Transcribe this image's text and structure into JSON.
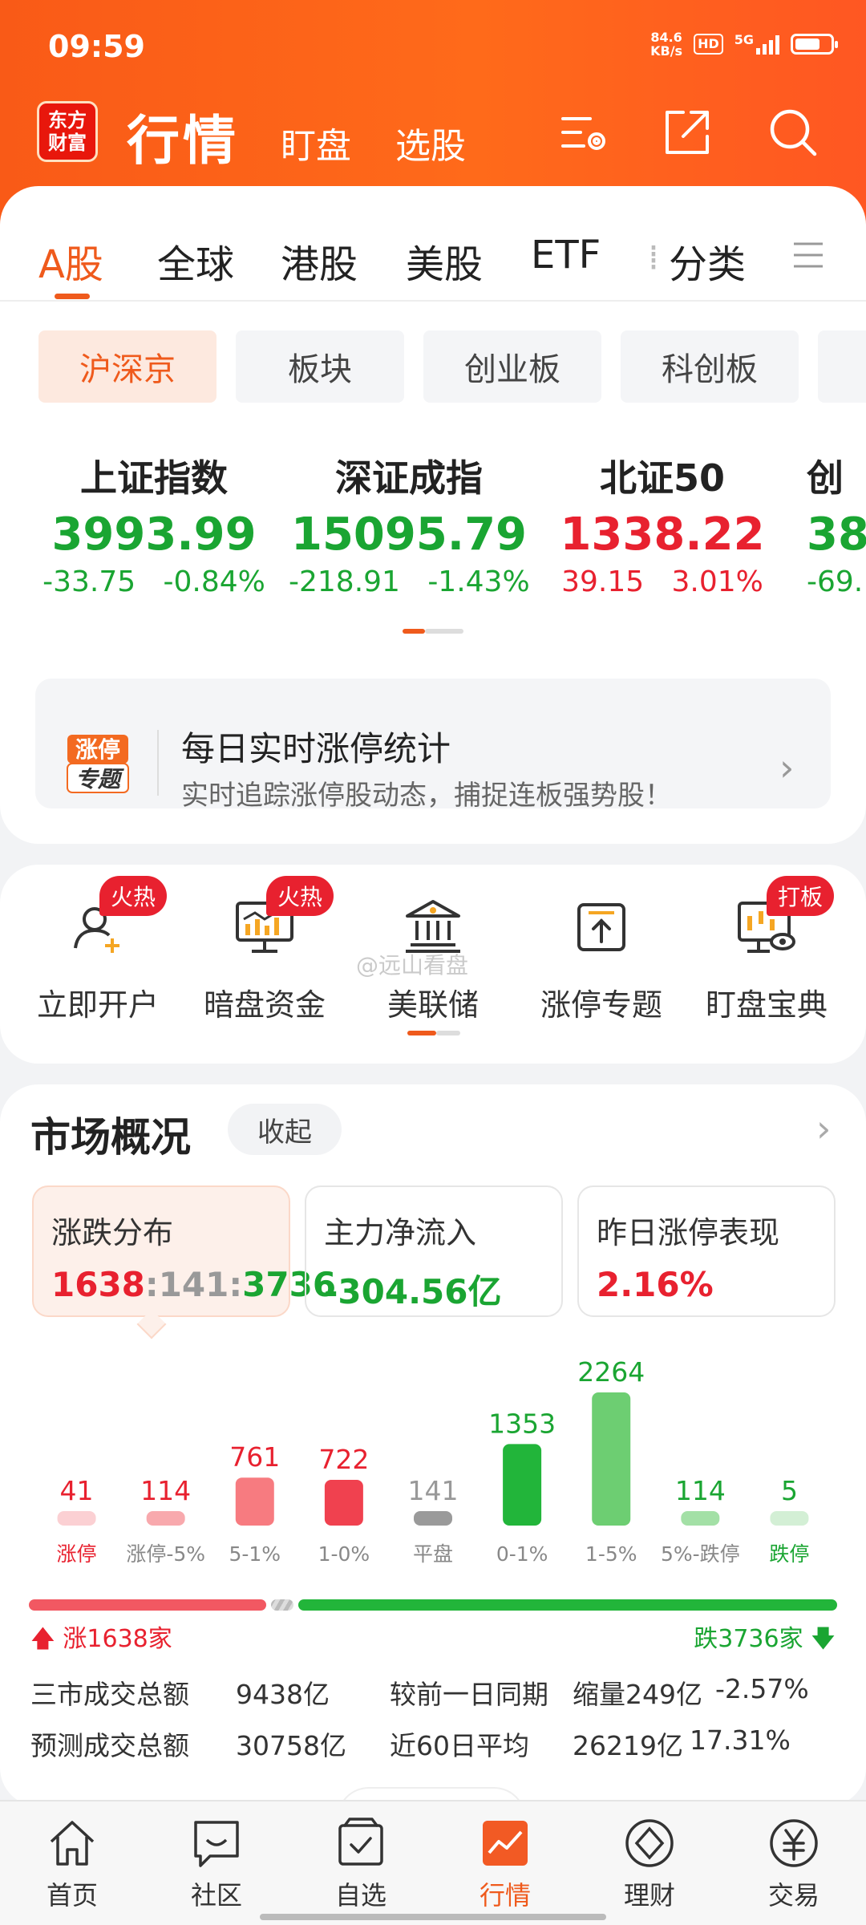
{
  "status_bar": {
    "time": "09:59",
    "net_speed": "84.6",
    "net_unit": "KB/s",
    "hd": "HD",
    "network": "5G"
  },
  "header": {
    "logo_line1": "东方",
    "logo_line2": "财富",
    "title": "行情",
    "tabs": [
      "盯盘",
      "选股"
    ],
    "icons": [
      "settings-list-icon",
      "share-icon",
      "search-icon"
    ]
  },
  "market_tabs": [
    "A股",
    "全球",
    "港股",
    "美股",
    "ETF",
    "分类"
  ],
  "sub_chips": [
    "沪深京",
    "板块",
    "创业板",
    "科创板"
  ],
  "indices": [
    {
      "name": "上证指数",
      "value": "3993.99",
      "change": "-33.75",
      "pct": "-0.84%",
      "dir": "down"
    },
    {
      "name": "深证成指",
      "value": "15095.79",
      "change": "-218.91",
      "pct": "-1.43%",
      "dir": "down"
    },
    {
      "name": "北证50",
      "value": "1338.22",
      "change": "39.15",
      "pct": "3.01%",
      "dir": "up"
    },
    {
      "name": "创",
      "value": "38",
      "change": "-69.",
      "pct": "",
      "dir": "down"
    }
  ],
  "banner": {
    "badge_line1": "涨停",
    "badge_line2": "专题",
    "title": "每日实时涨停统计",
    "subtitle": "实时追踪涨停股动态，捕捉连板强势股！"
  },
  "quick_menu": [
    {
      "label": "立即开户",
      "icon": "add-user-icon",
      "badge": "火热"
    },
    {
      "label": "暗盘资金",
      "icon": "monitor-chart-icon",
      "badge": "火热"
    },
    {
      "label": "美联储",
      "icon": "bank-icon",
      "badge": ""
    },
    {
      "label": "涨停专题",
      "icon": "upload-box-icon",
      "badge": ""
    },
    {
      "label": "盯盘宝典",
      "icon": "candlestick-monitor-icon",
      "badge": "打板"
    }
  ],
  "watermark": "@远山看盘",
  "market_overview": {
    "title": "市场概况",
    "collapse_label": "收起",
    "stats": [
      {
        "label": "涨跌分布",
        "rise": "1638",
        "flat": "141",
        "fall": "3736"
      },
      {
        "label": "主力净流入",
        "value": "-304.56亿"
      },
      {
        "label": "昨日涨停表现",
        "value": "2.16%"
      }
    ],
    "rise_summary": "涨1638家",
    "fall_summary": "跌3736家",
    "volume": {
      "total_label": "三市成交总额",
      "total_value": "9438亿",
      "compare_label": "较前一日同期",
      "compare_change": "缩量249亿",
      "compare_pct": "-2.57%",
      "forecast_label": "预测成交总额",
      "forecast_value": "30758亿",
      "avg_label": "近60日平均",
      "avg_value": "26219亿",
      "avg_pct": "17.31%"
    }
  },
  "chart_data": {
    "type": "bar",
    "title": "",
    "categories": [
      "涨停",
      "涨停-5%",
      "5-1%",
      "1-0%",
      "平盘",
      "0-1%",
      "1-5%",
      "5%-跌停",
      "跌停"
    ],
    "values": [
      41,
      114,
      761,
      722,
      141,
      1353,
      2264,
      114,
      5
    ],
    "colors": [
      "#fbd0d3",
      "#f8a9ad",
      "#f77b80",
      "#f0414f",
      "#9a9a9a",
      "#22b53a",
      "#6dce72",
      "#a3e0a6",
      "#d3efd5"
    ],
    "label_colors": [
      "#e8212f",
      "#e8212f",
      "#e8212f",
      "#e8212f",
      "#999999",
      "#1aa532",
      "#1aa532",
      "#1aa532",
      "#1aa532"
    ]
  },
  "bottom_nav": [
    {
      "label": "首页",
      "icon": "home-icon"
    },
    {
      "label": "社区",
      "icon": "community-icon"
    },
    {
      "label": "自选",
      "icon": "watchlist-icon"
    },
    {
      "label": "行情",
      "icon": "market-icon",
      "active": true
    },
    {
      "label": "理财",
      "icon": "finance-icon"
    },
    {
      "label": "交易",
      "icon": "trade-icon"
    }
  ],
  "colors": {
    "brand": "#ef5a1c",
    "up": "#e8212f",
    "down": "#1aa532"
  }
}
